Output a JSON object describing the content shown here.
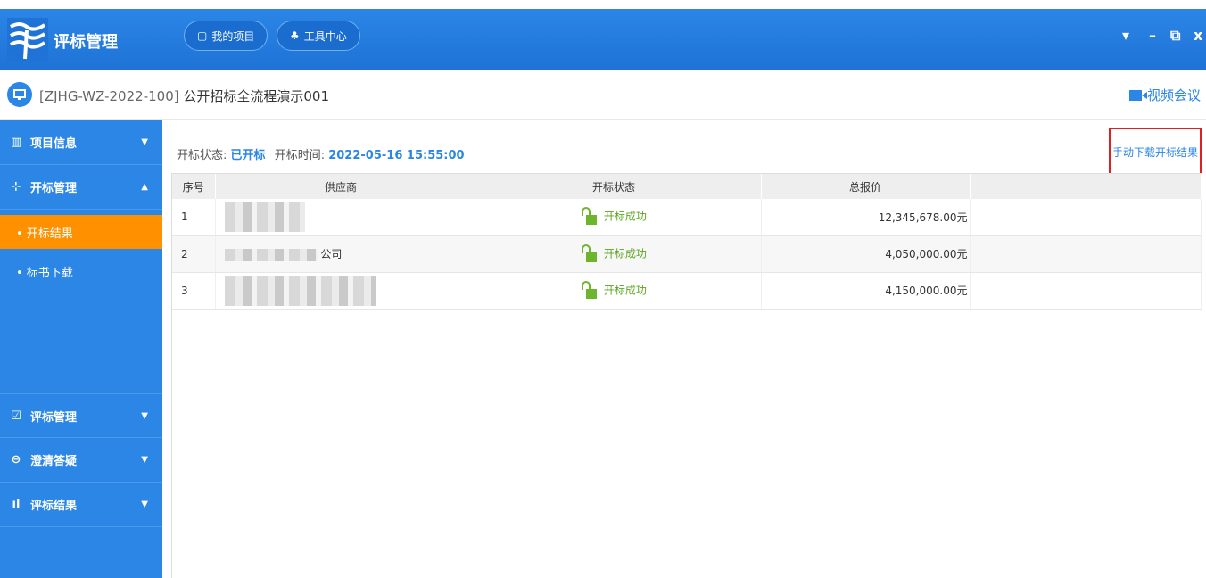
{
  "app": {
    "title": "评标管理"
  },
  "header": {
    "buttons": [
      {
        "label": "我的项目",
        "icon": "monitor-icon"
      },
      {
        "label": "工具中心",
        "icon": "tools-icon"
      }
    ],
    "window_controls": [
      "▾",
      "–",
      "⧉",
      "x"
    ]
  },
  "project": {
    "code": "[ZJHG-WZ-2022-100]",
    "name": "公开招标全流程演示001",
    "video_label": "视频会议"
  },
  "sidebar": {
    "items": [
      {
        "label": "项目信息",
        "icon": "info-icon"
      },
      {
        "label": "开标管理",
        "icon": "bid-open-icon"
      },
      {
        "label": "评标管理",
        "icon": "evaluate-icon"
      },
      {
        "label": "澄清答疑",
        "icon": "qa-icon"
      },
      {
        "label": "评标结果",
        "icon": "chart-icon"
      }
    ],
    "sub_items": [
      {
        "label": "• 开标结果"
      },
      {
        "label": "• 标书下载"
      }
    ]
  },
  "status": {
    "state_label": "开标状态:",
    "state_value": "已开标",
    "time_label": "开标时间:",
    "time_value": "2022-05-16 15:55:00"
  },
  "download_button": "手动下载开标结果",
  "table": {
    "headers": [
      "序号",
      "供应商",
      "开标状态",
      "总报价"
    ],
    "rows": [
      {
        "seq": "1",
        "supplier": "",
        "state": "开标成功",
        "price": "12,345,678.00元"
      },
      {
        "seq": "2",
        "supplier": "公司",
        "state": "开标成功",
        "price": "4,050,000.00元"
      },
      {
        "seq": "3",
        "supplier": "",
        "state": "开标成功",
        "price": "4,150,000.00元"
      }
    ]
  },
  "colors": {
    "primary": "#2b86e6",
    "active": "#ff9100",
    "success": "#5aa51e",
    "highlight": "#e02020"
  }
}
